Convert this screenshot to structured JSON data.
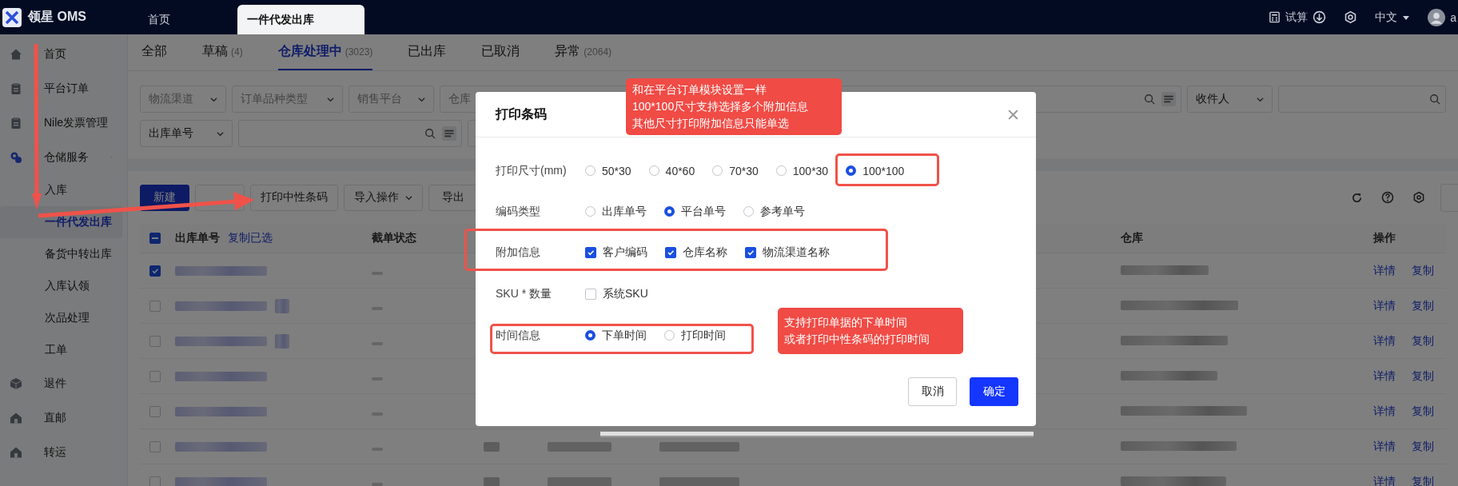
{
  "header": {
    "brand": "领星 OMS",
    "tabs": [
      {
        "label": "首页",
        "selected": false
      },
      {
        "label": "一件代发出库",
        "selected": true
      }
    ],
    "calculator": "试算",
    "language": "中文",
    "user": "a"
  },
  "sidebar": {
    "items": [
      {
        "label": "首页",
        "selected": false
      },
      {
        "label": "平台订单",
        "selected": false
      },
      {
        "label": "Nile发票管理",
        "selected": false
      },
      {
        "label": "仓储服务",
        "selected": false,
        "expanded": true,
        "children": [
          {
            "label": "入库",
            "selected": false
          },
          {
            "label": "一件代发出库",
            "selected": true
          },
          {
            "label": "备货中转出库",
            "selected": false
          },
          {
            "label": "入库认领",
            "selected": false
          },
          {
            "label": "次品处理",
            "selected": false
          },
          {
            "label": "工单",
            "selected": false
          }
        ]
      },
      {
        "label": "退件",
        "selected": false
      },
      {
        "label": "直邮",
        "selected": false
      },
      {
        "label": "转运",
        "selected": false
      }
    ]
  },
  "status_tabs": [
    {
      "label": "全部",
      "selected": false
    },
    {
      "label": "草稿",
      "count": "(4)",
      "selected": false
    },
    {
      "label": "仓库处理中",
      "count": "(3023)",
      "selected": true
    },
    {
      "label": "已出库",
      "selected": false
    },
    {
      "label": "已取消",
      "selected": false
    },
    {
      "label": "异常",
      "count": "(2064)",
      "selected": false
    }
  ],
  "filters": {
    "selects": [
      "物流渠道",
      "订单品种类型",
      "销售平台",
      "仓库"
    ],
    "search_type": "出库单号",
    "recipient": "收件人"
  },
  "toolbar": [
    {
      "label": "新建",
      "kind": "primary"
    },
    {
      "kind": "default"
    },
    {
      "label": "打印中性条码",
      "kind": "default"
    },
    {
      "label": "导入操作",
      "kind": "dropdown"
    },
    {
      "label": "导出",
      "kind": "default"
    }
  ],
  "table": {
    "select_all_indeterminate": true,
    "copy_link": "复制已选",
    "columns": [
      "出库单号",
      "截单状态",
      "仓库",
      "操作"
    ],
    "rows": [
      {
        "checked": true,
        "actions": [
          "详情",
          "复制"
        ]
      },
      {
        "checked": false,
        "actions": [
          "详情",
          "复制"
        ]
      },
      {
        "checked": false,
        "actions": [
          "详情",
          "复制"
        ]
      },
      {
        "checked": false,
        "actions": [
          "详情",
          "复制"
        ]
      },
      {
        "checked": false,
        "actions": [
          "详情",
          "复制"
        ]
      },
      {
        "checked": false,
        "actions": [
          "详情",
          "复制"
        ]
      },
      {
        "checked": false,
        "actions": [
          "详情",
          "复制"
        ]
      }
    ]
  },
  "dialog": {
    "title": "打印条码",
    "fields": [
      {
        "label": "打印尺寸(mm)",
        "kind": "radio",
        "options": [
          {
            "label": "50*30",
            "selected": false
          },
          {
            "label": "40*60",
            "selected": false
          },
          {
            "label": "70*30",
            "selected": false
          },
          {
            "label": "100*30",
            "selected": false
          },
          {
            "label": "100*100",
            "selected": true
          }
        ]
      },
      {
        "label": "编码类型",
        "kind": "radio",
        "options": [
          {
            "label": "出库单号",
            "selected": false
          },
          {
            "label": "平台单号",
            "selected": true
          },
          {
            "label": "参考单号",
            "selected": false
          }
        ]
      },
      {
        "label": "附加信息",
        "kind": "checkbox",
        "options": [
          {
            "label": "客户编码",
            "checked": true
          },
          {
            "label": "仓库名称",
            "checked": true
          },
          {
            "label": "物流渠道名称",
            "checked": true
          }
        ]
      },
      {
        "label": "SKU * 数量",
        "kind": "checkbox",
        "options": [
          {
            "label": "系统SKU",
            "checked": false
          }
        ]
      },
      {
        "label": "时间信息",
        "kind": "radio",
        "options": [
          {
            "label": "下单时间",
            "selected": true
          },
          {
            "label": "打印时间",
            "selected": false
          }
        ]
      }
    ],
    "cancel": "取消",
    "confirm": "确定"
  },
  "annotations": [
    {
      "lines": [
        "和在平台订单模块设置一样",
        "100*100尺寸支持选择多个附加信息",
        "其他尺寸打印附加信息只能单选"
      ]
    },
    {
      "lines": [
        "支持打印单据的下单时间",
        "或者打印中性条码的打印时间"
      ]
    }
  ]
}
